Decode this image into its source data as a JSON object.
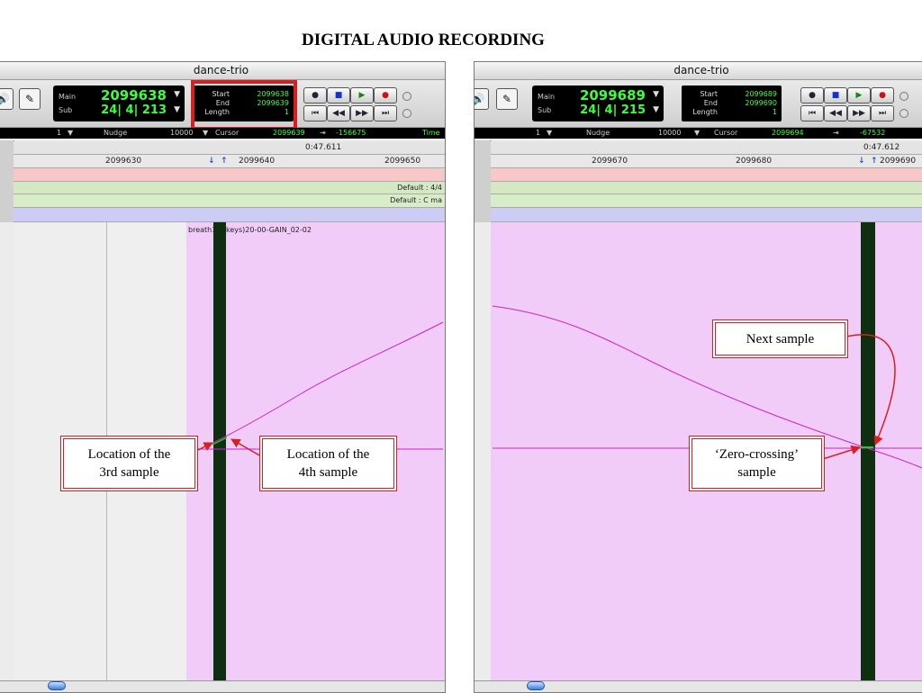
{
  "page_title": "DIGITAL AUDIO RECORDING",
  "left": {
    "window_title": "dance-trio",
    "main_label": "Main",
    "sub_label": "Sub",
    "main_counter": "2099638",
    "sub_counter": "24| 4| 213",
    "start_label": "Start",
    "end_label": "End",
    "length_label": "Length",
    "start_value": "2099638",
    "end_value": "2099639",
    "length_value": "1",
    "grid_value": "1",
    "nudge_label": "Nudge",
    "nudge_value": "10000",
    "cursor_label": "Cursor",
    "cursor_value": "2099639",
    "offset_value": "-156675",
    "time_label": "Time",
    "time_value": "0:47.611",
    "ruler_ticks": [
      "2099630",
      "2099640",
      "2099650"
    ],
    "meter_label": "Default : 4/4",
    "key_label": "Default : C ma",
    "clip_name": "breath1bCkeys)20-00-GAIN_02-02",
    "callout_3rd": "Location of the\n3rd sample",
    "callout_4th": "Location of the\n4th sample"
  },
  "right": {
    "window_title": "dance-trio",
    "main_label": "Main",
    "sub_label": "Sub",
    "main_counter": "2099689",
    "sub_counter": "24| 4| 215",
    "start_label": "Start",
    "end_label": "End",
    "length_label": "Length",
    "start_value": "2099689",
    "end_value": "2099690",
    "length_value": "1",
    "grid_value": "1",
    "nudge_label": "Nudge",
    "nudge_value": "10000",
    "cursor_label": "Cursor",
    "cursor_value": "2099694",
    "offset_value": "-67532",
    "time_value": "0:47.612",
    "ruler_ticks": [
      "2099670",
      "2099680",
      "2099690"
    ],
    "callout_next": "Next sample",
    "callout_zero": "‘Zero-crossing’\nsample"
  },
  "colors": {
    "accent_red": "#d81e1e",
    "counter_green": "#3cff3c",
    "region_pink": "#f2ccf8",
    "waveform": "#cc22cc",
    "cursor_dark": "#0f3010"
  },
  "icons": [
    "speaker-icon",
    "pencil-tool-icon",
    "record-icon",
    "stop-icon",
    "play-icon",
    "rewind-icon",
    "fast-forward-icon",
    "go-to-start-icon",
    "go-to-end-icon"
  ]
}
